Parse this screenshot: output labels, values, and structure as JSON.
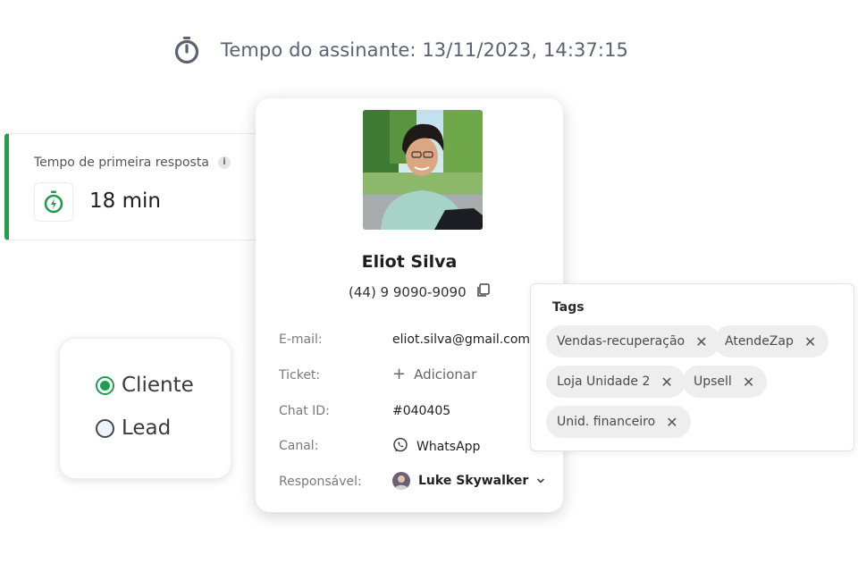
{
  "subscriber_time": {
    "label": "Tempo do assinante: 13/11/2023, 14:37:15"
  },
  "first_response": {
    "title": "Tempo de primeira resposta",
    "info": "i",
    "value": "18 min"
  },
  "contact_type": {
    "options": [
      {
        "label": "Cliente",
        "selected": true
      },
      {
        "label": "Lead",
        "selected": false
      }
    ]
  },
  "contact": {
    "name": "Eliot Silva",
    "phone": "(44) 9 9090-9090",
    "fields": {
      "email_label": "E-mail:",
      "email_value": "eliot.silva@gmail.com",
      "ticket_label": "Ticket:",
      "ticket_value": "Adicionar",
      "chat_label": "Chat ID:",
      "chat_value": "#040405",
      "channel_label": "Canal:",
      "channel_value": "WhatsApp",
      "owner_label": "Responsável:",
      "owner_value": "Luke Skywalker"
    }
  },
  "tags": {
    "title": "Tags",
    "items": [
      "Vendas-recuperação",
      "AtendeZap",
      "Loja Unidade 2",
      "Upsell",
      "Unid. financeiro"
    ]
  },
  "colors": {
    "accent_green": "#1f9d4b",
    "text_muted": "#7a7a7a"
  }
}
